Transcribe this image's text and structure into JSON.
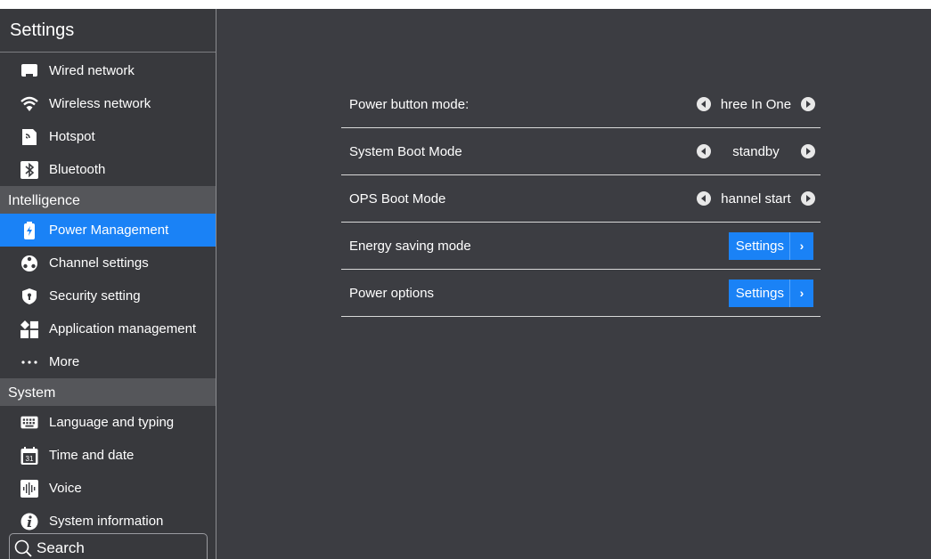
{
  "sidebar": {
    "title": "Settings",
    "network_items": [
      {
        "label": "Wired network",
        "icon": "monitor-icon"
      },
      {
        "label": "Wireless network",
        "icon": "wifi-icon"
      },
      {
        "label": "Hotspot",
        "icon": "hotspot-icon"
      },
      {
        "label": "Bluetooth",
        "icon": "bluetooth-icon"
      }
    ],
    "section_intelligence": "Intelligence",
    "intelligence_items": [
      {
        "label": "Power Management",
        "icon": "battery-icon",
        "active": true
      },
      {
        "label": "Channel settings",
        "icon": "channel-icon"
      },
      {
        "label": "Security setting",
        "icon": "shield-icon"
      },
      {
        "label": "Application management",
        "icon": "apps-icon"
      },
      {
        "label": "More",
        "icon": "more-icon"
      }
    ],
    "section_system": "System",
    "system_items": [
      {
        "label": "Language and typing",
        "icon": "keyboard-icon"
      },
      {
        "label": "Time and date",
        "icon": "calendar-icon"
      },
      {
        "label": "Voice",
        "icon": "voice-icon"
      },
      {
        "label": "System information",
        "icon": "info-icon"
      }
    ],
    "calendar_day": "31",
    "search_label": "Search"
  },
  "main": {
    "rows": [
      {
        "label": "Power button mode:",
        "value": "hree In One"
      },
      {
        "label": "System Boot Mode",
        "value": "standby"
      },
      {
        "label": "OPS Boot Mode",
        "value": "hannel start"
      },
      {
        "label": "Energy saving mode",
        "button": "Settings"
      },
      {
        "label": "Power options",
        "button": "Settings"
      }
    ]
  },
  "colors": {
    "accent": "#1a82f6",
    "background": "#3c3d42",
    "sidebar": "#38393d",
    "section": "#55565a"
  }
}
